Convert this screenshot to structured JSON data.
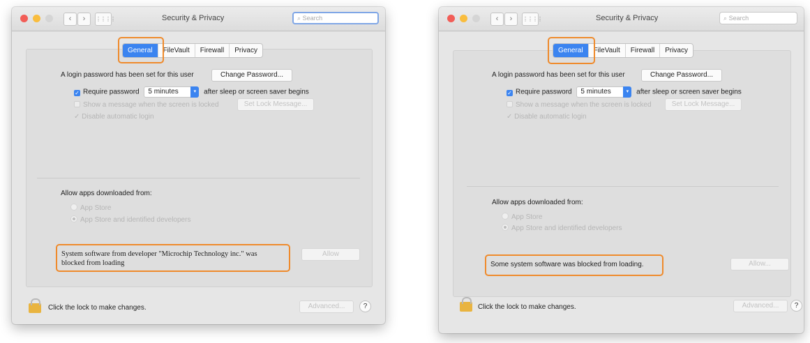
{
  "left": {
    "title": "Security & Privacy",
    "search_text": "Search",
    "tabs": [
      "General",
      "FileVault",
      "Firewall",
      "Privacy"
    ],
    "login_text": "A login password has been set for this user",
    "change_password": "Change Password...",
    "require_label": "Require password",
    "require_value": "5 minutes",
    "require_after": "after sleep or screen saver begins",
    "show_message": "Show a message when the screen is locked",
    "set_lock_message": "Set Lock Message...",
    "disable_login": "Disable automatic login",
    "allow_apps": "Allow apps downloaded from:",
    "app_store": "App Store",
    "app_store_dev": "App Store and identified developers",
    "blocked_line1": "System software from developer \"Microchip Technology inc.\" was",
    "blocked_line2": "blocked from loading",
    "allow_btn": "Allow",
    "lock_text": "Click the lock to make changes.",
    "advanced": "Advanced...",
    "help": "?"
  },
  "right": {
    "title": "Security & Privacy",
    "search_text": "Search",
    "tabs": [
      "General",
      "FileVault",
      "Firewall",
      "Privacy"
    ],
    "login_text": "A login password has been set for this user",
    "change_password": "Change Password...",
    "require_label": "Require password",
    "require_value": "5 minutes",
    "require_after": "after sleep or screen saver begins",
    "show_message": "Show a message when the screen is locked",
    "set_lock_message": "Set Lock Message...",
    "disable_login": "Disable automatic login",
    "allow_apps": "Allow apps downloaded from:",
    "app_store": "App Store",
    "app_store_dev": "App Store and identified developers",
    "blocked": "Some system software was blocked from loading.",
    "allow_btn": "Allow...",
    "lock_text": "Click the lock to make changes.",
    "advanced": "Advanced...",
    "help": "?"
  },
  "colors": {
    "accent": "#3b84f0",
    "highlight": "#ef8a2b",
    "lock": "#e9b440"
  },
  "icons": {
    "back": "‹",
    "forward": "›",
    "grid": "⋮⋮⋮⋮",
    "search": "⌕",
    "check": "✓"
  }
}
